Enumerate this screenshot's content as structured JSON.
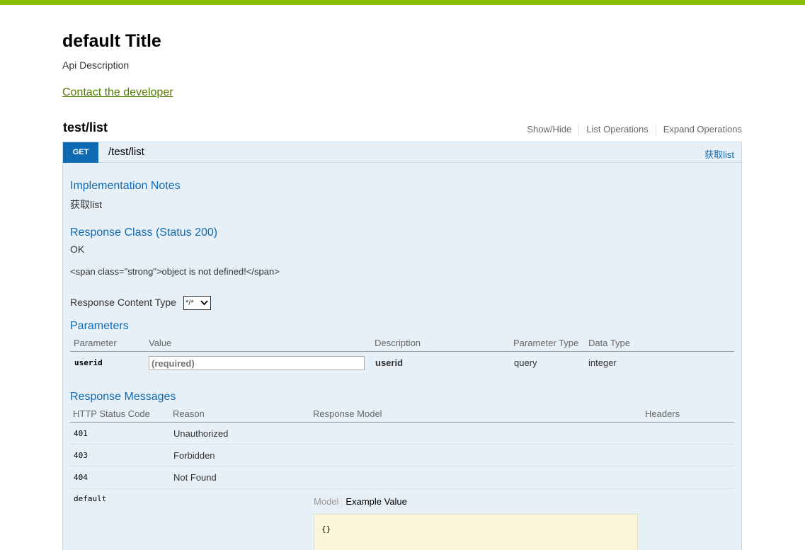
{
  "header": {
    "title": "default Title",
    "description": "Api Description",
    "contact_link": "Contact the developer"
  },
  "resource": {
    "name": "test/list",
    "ops": {
      "show_hide": "Show/Hide",
      "list_operations": "List Operations",
      "expand_operations": "Expand Operations"
    }
  },
  "operation": {
    "method": "GET",
    "path": "/test/list",
    "summary": "获取list",
    "impl_notes_heading": "Implementation Notes",
    "impl_notes": "获取list",
    "response_class_heading": "Response Class (Status 200)",
    "response_class_status": "OK",
    "response_class_html": "<span class=\"strong\">object is not defined!</span>",
    "content_type_label": "Response Content Type",
    "content_type_value": "*/*",
    "parameters_heading": "Parameters",
    "param_columns": {
      "parameter": "Parameter",
      "value": "Value",
      "description": "Description",
      "parameter_type": "Parameter Type",
      "data_type": "Data Type"
    },
    "params": [
      {
        "name": "userid",
        "placeholder": "(required)",
        "description": "userid",
        "parameter_type": "query",
        "data_type": "integer"
      }
    ],
    "response_messages_heading": "Response Messages",
    "resp_columns": {
      "status": "HTTP Status Code",
      "reason": "Reason",
      "model": "Response Model",
      "headers": "Headers"
    },
    "responses": [
      {
        "code": "401",
        "reason": "Unauthorized"
      },
      {
        "code": "403",
        "reason": "Forbidden"
      },
      {
        "code": "404",
        "reason": "Not Found"
      },
      {
        "code": "default",
        "reason": ""
      }
    ],
    "model_tab": "Model",
    "example_tab": "Example Value",
    "example_value": "{}"
  },
  "colors": {
    "accent_bar": "#89bf04",
    "get_method": "#0f6ab4",
    "link": "#547f00",
    "op_background": "#e7f0f7"
  },
  "icons": {
    "select_arrow": "chevron-down-icon"
  }
}
